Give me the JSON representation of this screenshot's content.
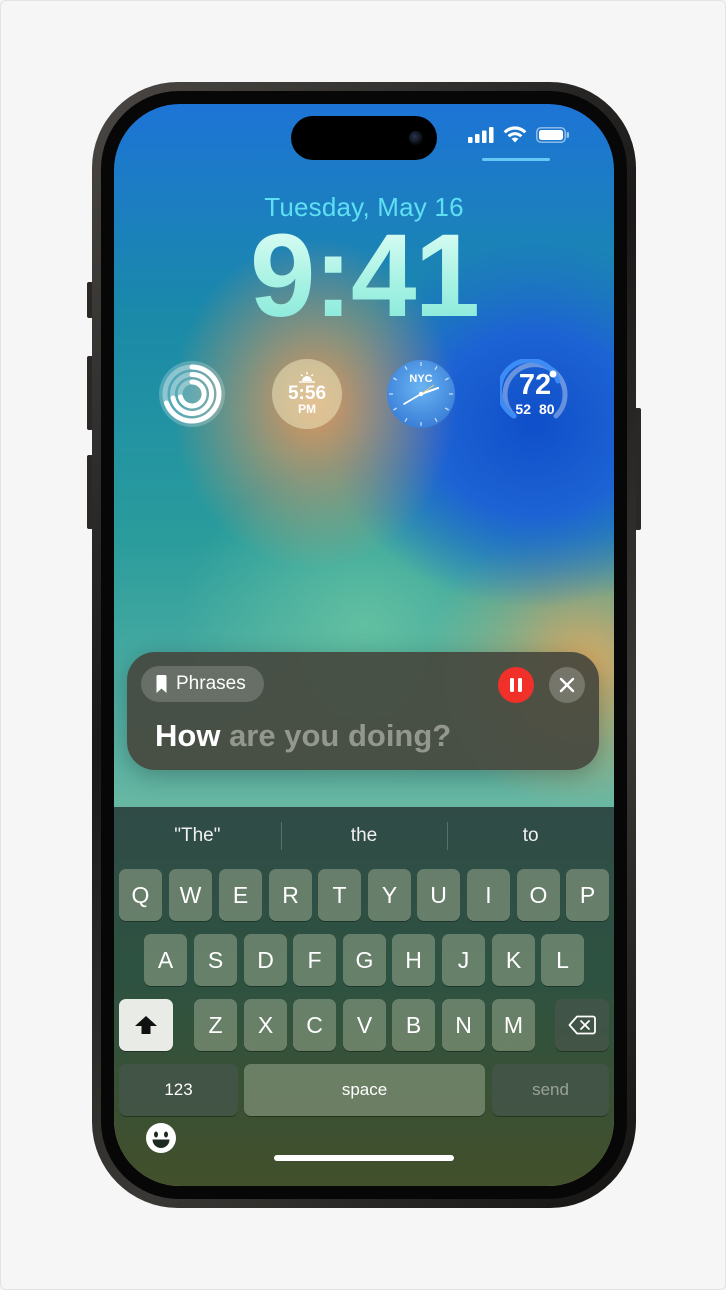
{
  "lock_screen": {
    "date": "Tuesday, May 16",
    "time": "9:41"
  },
  "widgets": {
    "activity": {
      "icon": "activity-rings-icon"
    },
    "sunrise": {
      "time": "5:56",
      "period": "PM",
      "icon": "sunset-icon"
    },
    "world_clock": {
      "city": "NYC"
    },
    "weather": {
      "temperature": "72",
      "low": "52",
      "high": "80"
    }
  },
  "live_speech": {
    "phrases_label": "Phrases",
    "spoken_text": "How",
    "pending_text": "are you doing?",
    "accent_color": "#f2302a"
  },
  "keyboard": {
    "predictions": [
      "\"The\"",
      "the",
      "to"
    ],
    "row1": [
      "Q",
      "W",
      "E",
      "R",
      "T",
      "Y",
      "U",
      "I",
      "O",
      "P"
    ],
    "row2": [
      "A",
      "S",
      "D",
      "F",
      "G",
      "H",
      "J",
      "K",
      "L"
    ],
    "row3": [
      "Z",
      "X",
      "C",
      "V",
      "B",
      "N",
      "M"
    ],
    "numbers_label": "123",
    "space_label": "space",
    "send_label": "send"
  }
}
